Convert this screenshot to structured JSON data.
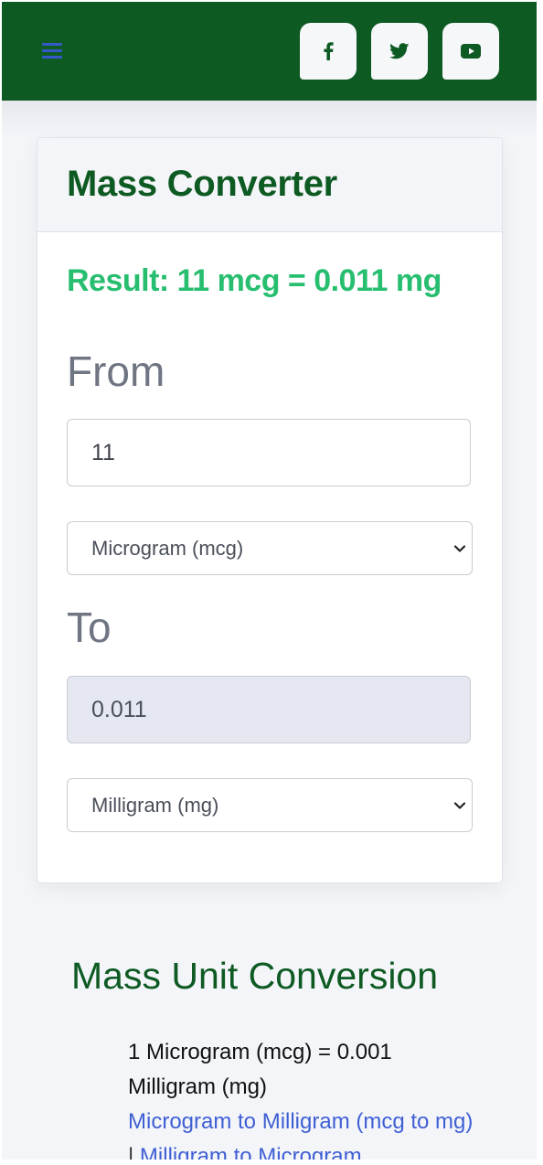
{
  "header": {
    "menu_icon": "hamburger-menu-icon",
    "social": [
      {
        "name": "facebook",
        "icon": "facebook-icon"
      },
      {
        "name": "twitter",
        "icon": "twitter-icon"
      },
      {
        "name": "youtube",
        "icon": "youtube-icon"
      }
    ]
  },
  "converter": {
    "title": "Mass Converter",
    "result": "Result: 11 mcg = 0.011 mg",
    "from_label": "From",
    "from_value": "11",
    "from_unit": "Microgram (mcg)",
    "to_label": "To",
    "to_value": "0.011",
    "to_unit": "Milligram (mg)"
  },
  "unit_conversion": {
    "title": "Mass Unit Conversion",
    "equation": "1 Microgram (mcg) = 0.001 Milligram (mg)",
    "link_1": "Microgram to Milligram (mcg to mg)",
    "separator": "|",
    "link_2": "Milligram to Microgram"
  },
  "colors": {
    "brand_green": "#0e5a23",
    "result_green": "#27be70",
    "link_blue": "#3f5fd4",
    "menu_blue": "#3559c7"
  }
}
